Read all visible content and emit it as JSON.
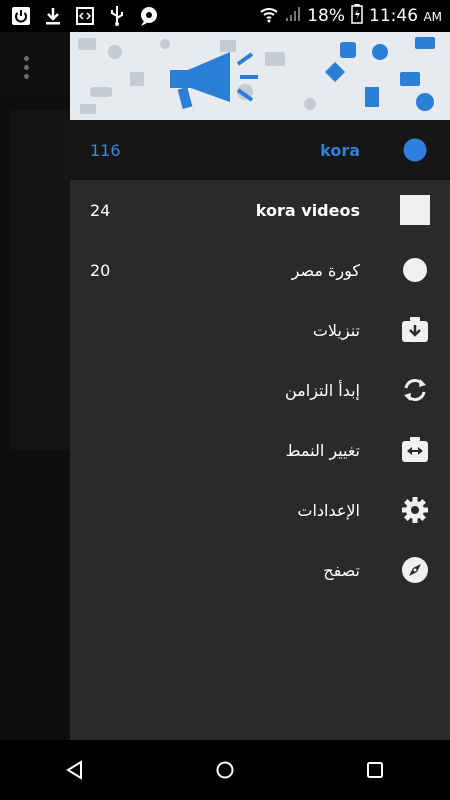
{
  "status_bar": {
    "battery_percent": "18%",
    "time": "11:46",
    "ampm": "AM",
    "icons": [
      "power-icon",
      "download-icon",
      "code-icon",
      "usb-icon",
      "chat-icon",
      "wifi-icon",
      "signal-icon",
      "battery-icon"
    ]
  },
  "drawer": {
    "items": [
      {
        "label": "kora",
        "count": "116",
        "icon": "blue-dot-icon",
        "active": true
      },
      {
        "label": "kora videos",
        "count": "24",
        "icon": "white-square-icon"
      },
      {
        "label": "كورة مصر",
        "count": "20",
        "icon": "white-circle-icon"
      },
      {
        "label": "تنزيلات",
        "count": "",
        "icon": "download-box-icon"
      },
      {
        "label": "إبدأ التزامن",
        "count": "",
        "icon": "sync-icon"
      },
      {
        "label": "تغيير النمط",
        "count": "",
        "icon": "swap-layout-icon"
      },
      {
        "label": "الإعدادات",
        "count": "",
        "icon": "gear-icon"
      },
      {
        "label": "تصفح",
        "count": "",
        "icon": "compass-icon"
      }
    ]
  },
  "colors": {
    "accent": "#2f7fdc",
    "drawer_bg": "#2a2a2a",
    "active_bg": "#161616"
  }
}
